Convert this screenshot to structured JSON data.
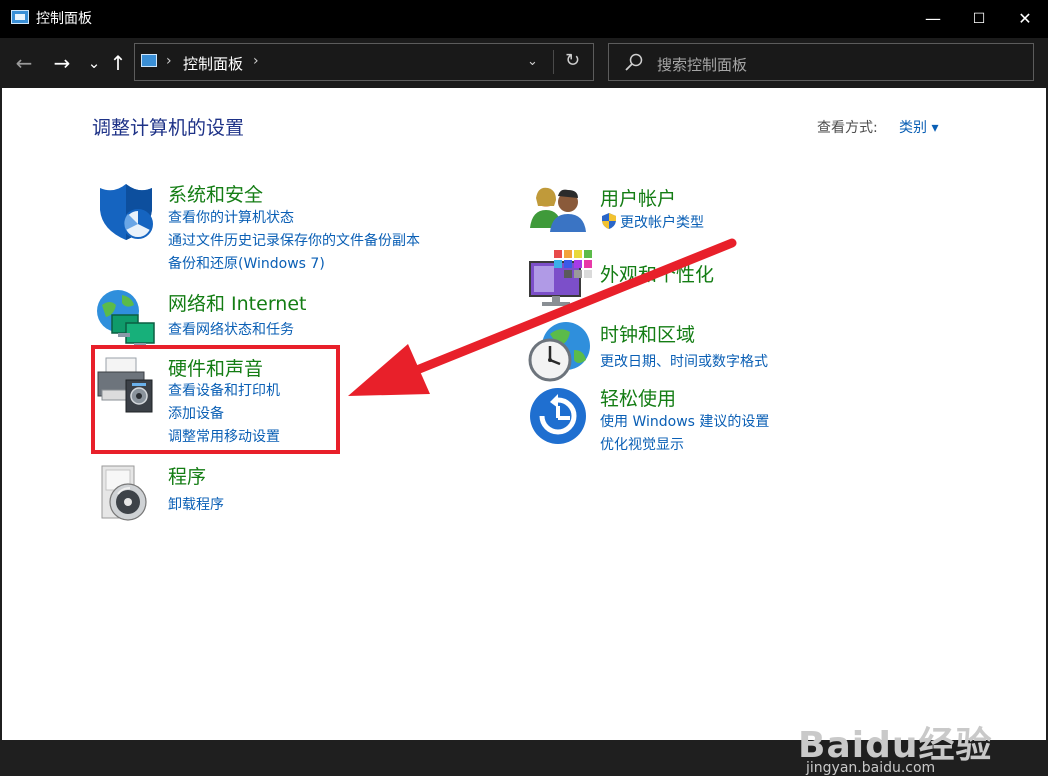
{
  "window": {
    "title": "控制面板",
    "controls": {
      "minimize": "—",
      "maximize": "☐",
      "close": "✕"
    }
  },
  "nav": {
    "back": "←",
    "forward": "→",
    "recent": "⌄",
    "up": "↑",
    "address_crumb": "控制面板",
    "address_sep": "›",
    "address_dropdown": "⌄",
    "refresh": "↻",
    "search_placeholder": "搜索控制面板"
  },
  "main": {
    "heading": "调整计算机的设置",
    "view_by_label": "查看方式:",
    "view_by_value": "类别 ▾"
  },
  "categories_left": [
    {
      "title": "系统和安全",
      "links": [
        "查看你的计算机状态",
        "通过文件历史记录保存你的文件备份副本",
        "备份和还原(Windows 7)"
      ]
    },
    {
      "title": "网络和 Internet",
      "links": [
        "查看网络状态和任务"
      ]
    },
    {
      "title": "硬件和声音",
      "links": [
        "查看设备和打印机",
        "添加设备",
        "调整常用移动设置"
      ]
    },
    {
      "title": "程序",
      "links": [
        "卸载程序"
      ]
    }
  ],
  "categories_right": [
    {
      "title": "用户帐户",
      "links": [
        "更改帐户类型"
      ]
    },
    {
      "title": "外观和个性化",
      "links": []
    },
    {
      "title": "时钟和区域",
      "links": [
        "更改日期、时间或数字格式"
      ]
    },
    {
      "title": "轻松使用",
      "links": [
        "使用 Windows 建议的设置",
        "优化视觉显示"
      ]
    }
  ],
  "annotation": {
    "highlight_color": "#e8202a",
    "arrow_color": "#e8202a"
  },
  "watermark": {
    "main": "Baidu经验",
    "sub": "jingyan.baidu.com"
  },
  "colors": {
    "title_green": "#147d14",
    "link_blue": "#0a5fb5",
    "heading_navy": "#1e3287"
  }
}
